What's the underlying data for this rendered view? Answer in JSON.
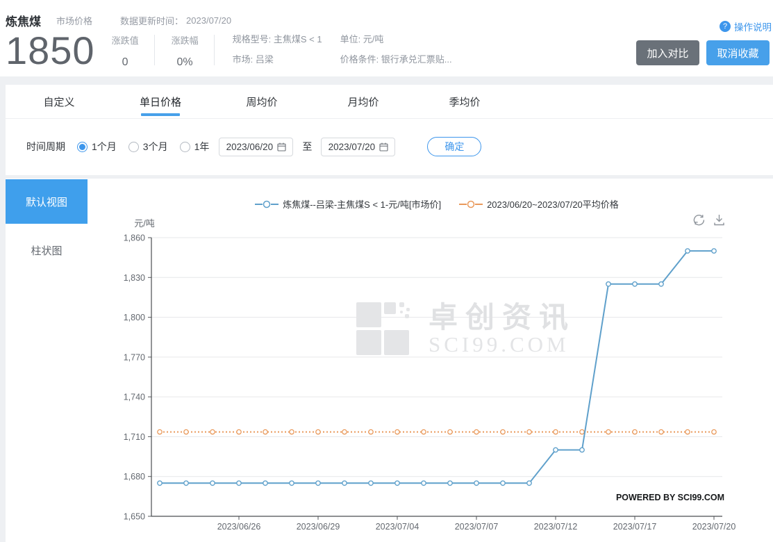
{
  "header": {
    "title": "炼焦煤",
    "category": "市场价格",
    "update_label": "数据更新时间：",
    "update_date": "2023/07/20",
    "help": "操作说明",
    "help_icon": "?",
    "price": "1850",
    "change_value_label": "涨跌值",
    "change_value": "0",
    "change_pct_label": "涨跌幅",
    "change_pct": "0%",
    "spec": "规格型号: 主焦煤S < 1",
    "market": "市场: 吕梁",
    "unit": "单位: 元/吨",
    "condition": "价格条件: 银行承兑汇票贴...",
    "compare_btn": "加入对比",
    "unfav_btn": "取消收藏"
  },
  "tabs": {
    "items": [
      {
        "label": "自定义"
      },
      {
        "label": "单日价格"
      },
      {
        "label": "周均价"
      },
      {
        "label": "月均价"
      },
      {
        "label": "季均价"
      }
    ],
    "active": "单日价格"
  },
  "filter": {
    "label": "时间周期",
    "options": [
      {
        "label": "1个月",
        "checked": true
      },
      {
        "label": "3个月",
        "checked": false
      },
      {
        "label": "1年",
        "checked": false
      }
    ],
    "start_date": "2023/06/20",
    "to": "至",
    "end_date": "2023/07/20",
    "confirm": "确定"
  },
  "sidebar": {
    "items": [
      {
        "label": "默认视图",
        "active": true
      },
      {
        "label": "柱状图",
        "active": false
      }
    ]
  },
  "chart": {
    "unit": "元/吨",
    "watermark_cn": "卓创资讯",
    "watermark_en": "SCI99.COM",
    "powered_by": "POWERED BY SCI99.COM",
    "refresh_icon": "refresh",
    "download_icon": "download"
  },
  "chart_data": {
    "type": "line",
    "title": "",
    "xlabel": "",
    "ylabel": "元/吨",
    "ylim": [
      1650,
      1860
    ],
    "y_ticks": [
      1650,
      1680,
      1710,
      1740,
      1770,
      1800,
      1830,
      1860
    ],
    "grid": true,
    "legend_position": "top",
    "x": [
      "2023/06/20",
      "2023/06/21",
      "2023/06/25",
      "2023/06/26",
      "2023/06/27",
      "2023/06/28",
      "2023/06/29",
      "2023/06/30",
      "2023/07/03",
      "2023/07/04",
      "2023/07/05",
      "2023/07/06",
      "2023/07/07",
      "2023/07/10",
      "2023/07/11",
      "2023/07/12",
      "2023/07/13",
      "2023/07/14",
      "2023/07/17",
      "2023/07/18",
      "2023/07/19",
      "2023/07/20"
    ],
    "x_tick_indices": [
      3,
      6,
      9,
      12,
      15,
      18,
      21
    ],
    "series": [
      {
        "name": "炼焦煤--吕梁-主焦煤S < 1-元/吨[市场价]",
        "type": "line",
        "color": "#5fa0cb",
        "values": [
          1675,
          1675,
          1675,
          1675,
          1675,
          1675,
          1675,
          1675,
          1675,
          1675,
          1675,
          1675,
          1675,
          1675,
          1675,
          1700,
          1700,
          1825,
          1825,
          1825,
          1850,
          1850
        ]
      },
      {
        "name": "2023/06/20~2023/07/20平均价格",
        "type": "average-line",
        "color": "#e9995b",
        "value": 1713.6
      }
    ]
  }
}
